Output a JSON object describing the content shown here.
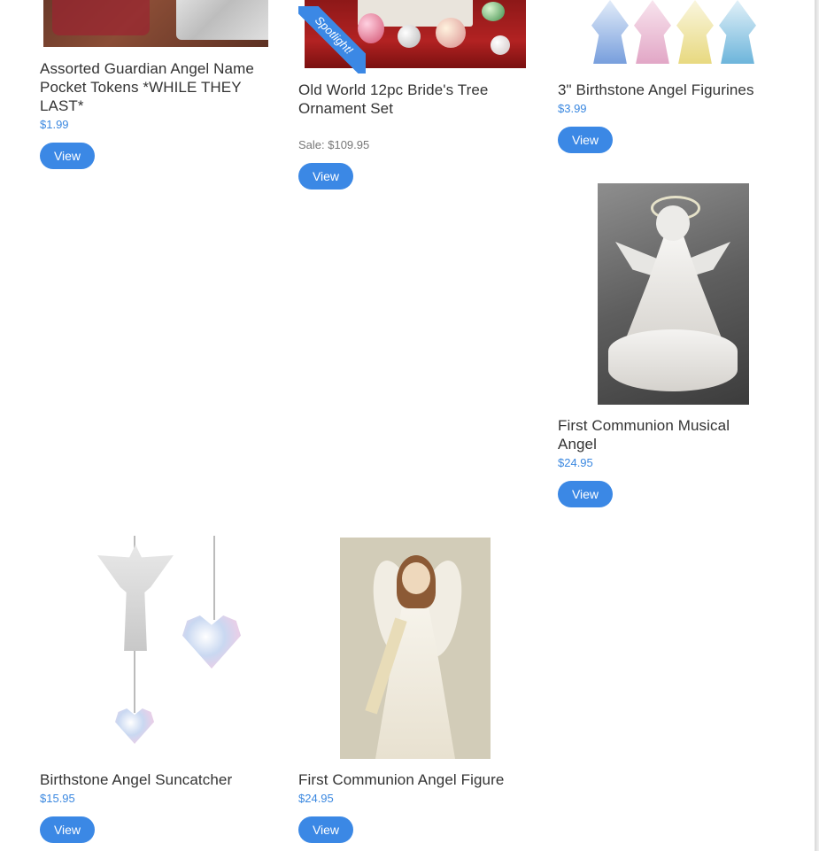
{
  "products": [
    {
      "title": "Assorted Guardian Angel Name Pocket Tokens *WHILE THEY LAST*",
      "price": "$1.99",
      "button": "View"
    },
    {
      "title": "Old World 12pc Bride's Tree Ornament Set",
      "price": "",
      "sale": "Sale: $109.95",
      "badge": "Spotlight!",
      "button": "View"
    },
    {
      "title": "3\" Birthstone Angel Figurines",
      "price": "$3.99",
      "button": "View"
    },
    {
      "title": "First Communion Musical Angel",
      "price": "$24.95",
      "button": "View"
    },
    {
      "title": "Birthstone Angel Suncatcher",
      "price": "$15.95",
      "button": "View"
    },
    {
      "title": "First Communion Angel Figure",
      "price": "$24.95",
      "button": "View"
    }
  ],
  "colors": {
    "accent": "#3b88e5",
    "price": "#3b88e0"
  }
}
